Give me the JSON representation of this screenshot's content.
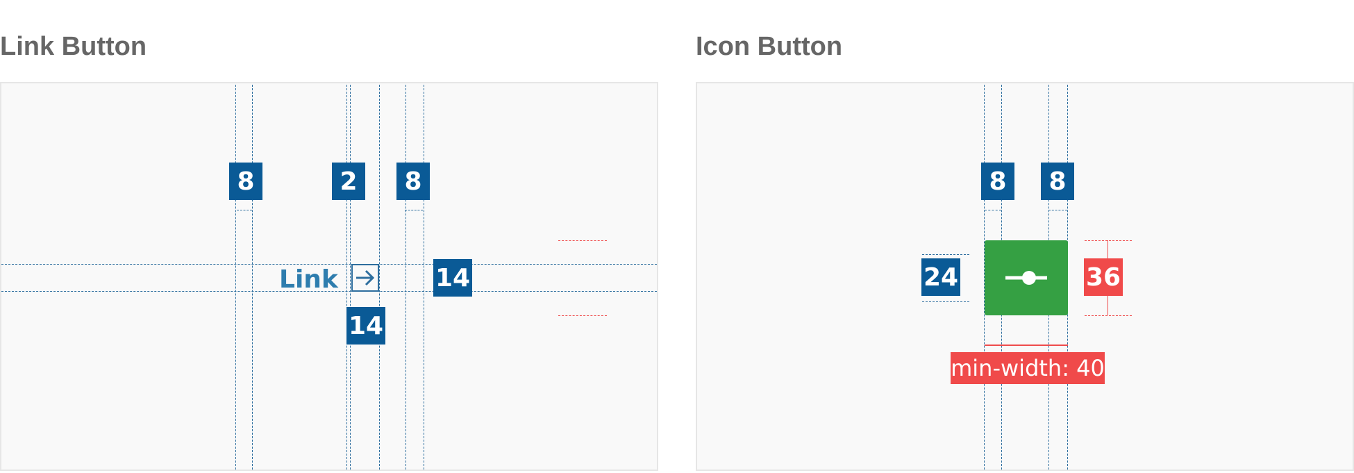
{
  "link_section": {
    "title": "Link Button",
    "button_label": "Link",
    "icon": "arrow-right-icon",
    "spacing": {
      "left": "8",
      "gap": "2",
      "right": "8",
      "icon_size": "14",
      "height": "14"
    }
  },
  "icon_section": {
    "title": "Icon Button",
    "icon": "slider-icon",
    "spacing": {
      "left": "8",
      "right": "8",
      "icon_size": "24",
      "height": "36"
    },
    "min_width_label": "min-width: 40"
  },
  "colors": {
    "measure_blue": "#0a5a96",
    "measure_red": "#f04a4a",
    "button_green": "#35a043",
    "link_blue": "#2e7dae"
  }
}
